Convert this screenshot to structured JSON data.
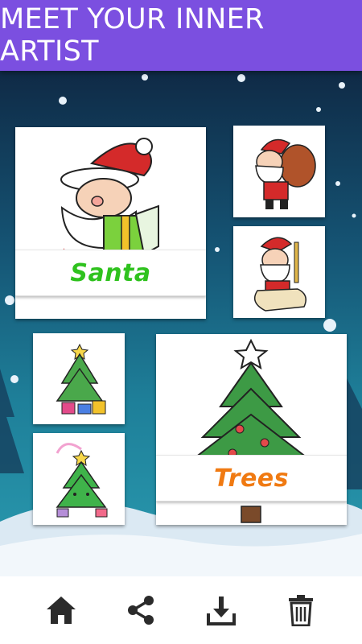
{
  "header": {
    "title": "MEET YOUR INNER ARTIST"
  },
  "cards": {
    "santa": {
      "label": "Santa",
      "label_color": "#2fc21e"
    },
    "trees": {
      "label": "Trees",
      "label_color": "#f07a12"
    }
  },
  "bottom_bar": {
    "icons": [
      "home-icon",
      "share-icon",
      "download-icon",
      "trash-icon"
    ]
  },
  "colors": {
    "header_bg": "#7B4FE0",
    "icon_color": "#2b2b2b"
  }
}
